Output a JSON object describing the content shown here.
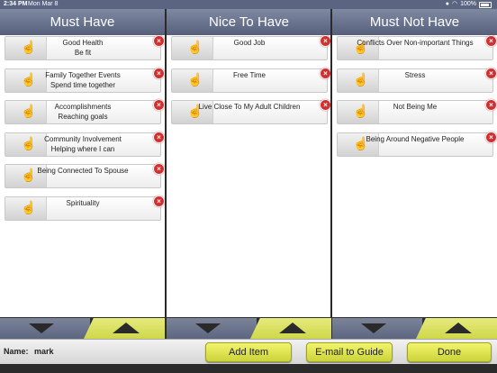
{
  "status_bar": {
    "time": "2:34 PM",
    "date": "Mon Mar 8",
    "battery": "100%"
  },
  "columns": [
    {
      "title": "Must Have",
      "items": [
        {
          "lines": [
            "Good Health",
            "Be fit"
          ]
        },
        {
          "lines": [
            "Family Together Events",
            "Spend time together"
          ]
        },
        {
          "lines": [
            "Accomplishments",
            "Reaching goals"
          ]
        },
        {
          "lines": [
            "Community Involvement",
            "Helping where I can"
          ]
        },
        {
          "lines": [
            "Being Connected To Spouse"
          ]
        },
        {
          "lines": [
            "Spirituality"
          ]
        }
      ]
    },
    {
      "title": "Nice To Have",
      "items": [
        {
          "lines": [
            "Good Job"
          ]
        },
        {
          "lines": [
            "Free Time"
          ]
        },
        {
          "lines": [
            "Live Close To My Adult Children"
          ]
        }
      ]
    },
    {
      "title": "Must Not Have",
      "items": [
        {
          "lines": [
            "Conflicts Over Non-important Things"
          ]
        },
        {
          "lines": [
            "Stress"
          ]
        },
        {
          "lines": [
            "Not Being Me"
          ]
        },
        {
          "lines": [
            "Being Around Negative People"
          ]
        }
      ]
    }
  ],
  "bottom_bar": {
    "name_label": "Name:",
    "name_value": "mark",
    "add_item": "Add Item",
    "email": "E-mail to Guide",
    "done": "Done"
  },
  "icons": {
    "delete": "delete-icon",
    "drag": "drag-hand-icon",
    "down": "arrow-down-icon",
    "up": "arrow-up-icon"
  },
  "colors": {
    "header": "#5b6581",
    "accent_yellow": "#d8e04c",
    "delete_red": "#d23030"
  }
}
